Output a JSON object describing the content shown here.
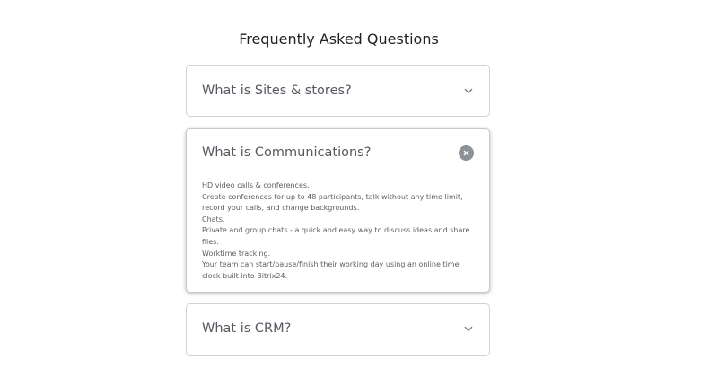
{
  "page": {
    "title": "Frequently Asked Questions"
  },
  "faq": [
    {
      "question": "What is Sites & stores?",
      "state": "collapsed",
      "toggle_icon": "chevron-down-icon"
    },
    {
      "question": "What is Communications?",
      "state": "expanded",
      "toggle_icon": "close-icon",
      "answer_lines": [
        "HD video calls & conferences.",
        "Create conferences for up to 48 participants, talk without any time limit, record your calls, and change backgrounds.",
        "Chats.",
        "Private and group chats - a quick and easy way to discuss ideas and share files.",
        "Worktime tracking.",
        "Your team can start/pause/finish their working day using an online time clock built into Bitrix24."
      ]
    },
    {
      "question": "What is CRM?",
      "state": "collapsed",
      "toggle_icon": "chevron-down-icon"
    }
  ]
}
